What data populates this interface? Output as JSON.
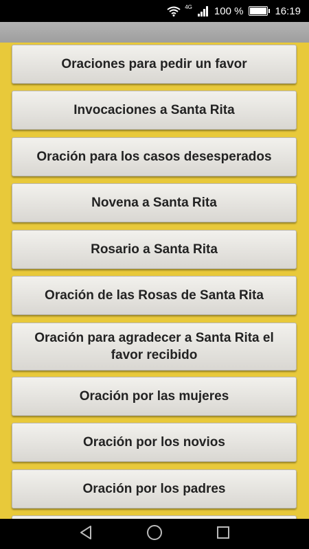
{
  "status_bar": {
    "network": "4G",
    "battery_percent": "100 %",
    "battery_level": 1.0,
    "time": "16:19"
  },
  "menu_items": [
    "Oraciones para pedir un favor",
    "Invocaciones a Santa Rita",
    "Oración para los casos desesperados",
    "Novena a Santa Rita",
    "Rosario a Santa Rita",
    "Oración de las Rosas de Santa Rita",
    "Oración para agradecer a Santa Rita el favor recibido",
    "Oración por las mujeres",
    "Oración por los novios",
    "Oración por los padres"
  ],
  "colors": {
    "background": "#e8c93a",
    "app_bar": "#a8a8a8",
    "button": "#e6e4df",
    "text": "#222222"
  },
  "icons": [
    "wifi-icon",
    "signal-icon",
    "battery-icon",
    "back-icon",
    "home-icon",
    "recents-icon"
  ]
}
